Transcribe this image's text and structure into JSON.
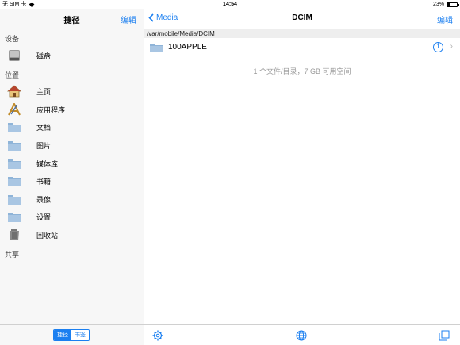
{
  "status": {
    "carrier": "无 SIM 卡",
    "time": "14:54",
    "battery": "23%",
    "battery_level": 0.23
  },
  "sidebar": {
    "title": "捷径",
    "edit": "编辑",
    "sections": {
      "devices": "设备",
      "locations": "位置",
      "shared": "共享"
    },
    "disk": "磁盘",
    "items": [
      {
        "label": "主页",
        "icon": "home-icon"
      },
      {
        "label": "应用程序",
        "icon": "applications-icon"
      },
      {
        "label": "文档",
        "icon": "folder-icon"
      },
      {
        "label": "图片",
        "icon": "folder-icon"
      },
      {
        "label": "媒体库",
        "icon": "folder-icon"
      },
      {
        "label": "书籍",
        "icon": "folder-icon"
      },
      {
        "label": "录像",
        "icon": "folder-icon"
      },
      {
        "label": "设置",
        "icon": "folder-icon"
      },
      {
        "label": "回收站",
        "icon": "trash-icon"
      }
    ],
    "segments": [
      "捷径",
      "书签"
    ]
  },
  "main": {
    "back": "Media",
    "title": "DCIM",
    "edit": "编辑",
    "path": "/var/mobile/Media/DCIM",
    "rows": [
      {
        "name": "100APPLE"
      }
    ],
    "summary": "1 个文件/目录，7 GB 可用空间"
  },
  "colors": {
    "accent": "#1b7ff0",
    "folder": "#8fb4d8"
  }
}
